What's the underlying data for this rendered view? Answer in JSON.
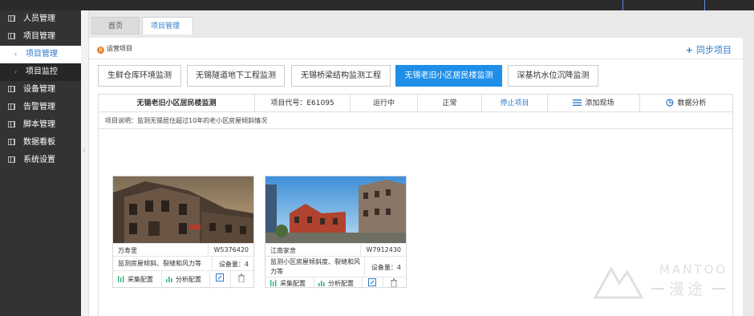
{
  "sidebar": {
    "items": [
      {
        "label": "人员管理",
        "icon": "grid-icon",
        "sub": false
      },
      {
        "label": "项目管理",
        "icon": "grid-icon",
        "sub": false
      },
      {
        "label": "项目管理",
        "icon": "caret-right-icon",
        "sub": true,
        "active": true
      },
      {
        "label": "项目监控",
        "icon": "caret-right-icon",
        "sub": true
      },
      {
        "label": "设备管理",
        "icon": "grid-icon",
        "sub": false
      },
      {
        "label": "告警管理",
        "icon": "grid-icon",
        "sub": false
      },
      {
        "label": "脚本管理",
        "icon": "grid-icon",
        "sub": false
      },
      {
        "label": "数据看板",
        "icon": "grid-icon",
        "sub": false
      },
      {
        "label": "系统设置",
        "icon": "grid-icon",
        "sub": false
      }
    ]
  },
  "tabs": {
    "home": "首页",
    "project": "项目管理",
    "close_glyph": "✕"
  },
  "panel": {
    "title": "运营项目",
    "sync_label": "同步项目",
    "title_icon_glyph": "B"
  },
  "project_buttons": [
    {
      "label": "生鲜仓库环境监测"
    },
    {
      "label": "无锡隧道地下工程监测"
    },
    {
      "label": "无锡桥梁结构监测工程"
    },
    {
      "label": "无锡老旧小区居民楼监测",
      "active": true
    },
    {
      "label": "深基坑水位沉降监测"
    }
  ],
  "project_info": {
    "name": "无锡老旧小区居民楼监测",
    "code": "项目代号：E61095",
    "status": "运行中",
    "health": "正常",
    "stop_label": "停止项目",
    "add_site_label": "添加现场",
    "analysis_label": "数据分析",
    "description": "项目说明：监测无锡居住超过10年的老小区房屋倾斜情况"
  },
  "sites": [
    {
      "name": "万寿里",
      "code": "W5376420",
      "description": "监测房屋倾斜、裂缝和风力等",
      "device_count": "设备量：4",
      "collect_label": "采集配置",
      "analysis_label": "分析配置"
    },
    {
      "name": "江南家舍",
      "code": "W7912430",
      "description": "监测小区房屋倾斜度、裂缝和风力等",
      "device_count": "设备量：4",
      "collect_label": "采集配置",
      "analysis_label": "分析配置"
    }
  ],
  "watermark": {
    "brand_en": "MANTOO",
    "brand_cn": "漫途"
  },
  "colors": {
    "accent": "#1e8ee8",
    "link": "#2d7ccc",
    "sidebar": "#333333",
    "green": "#2bb673",
    "orange": "#e8822e"
  }
}
